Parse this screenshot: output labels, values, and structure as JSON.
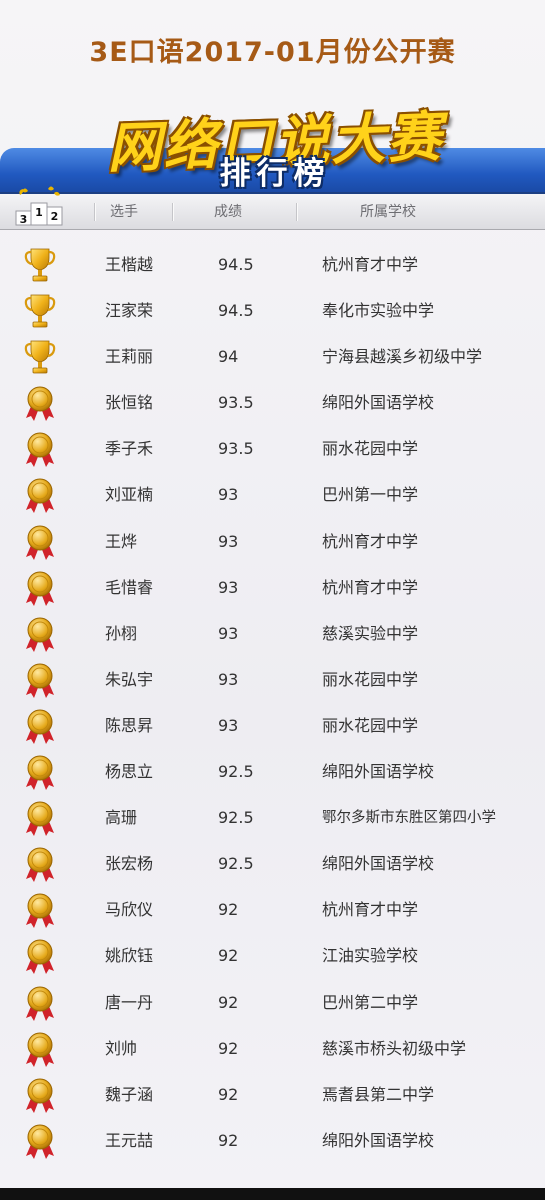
{
  "header": {
    "title": "3E口语2017-01月份公开赛",
    "banner_main": "网络口说大赛",
    "banner_sub": "排行榜"
  },
  "podium": {
    "left": "3",
    "center": "1",
    "right": "2"
  },
  "columns": {
    "player": "选手",
    "score": "成绩",
    "school": "所属学校"
  },
  "colors": {
    "accent": "#a65a16",
    "banner": "#2159c0",
    "gold": "#ffd21a"
  },
  "rows": [
    {
      "icon": "trophy-icon",
      "name": "王楷越",
      "score": "94.5",
      "school": "杭州育才中学"
    },
    {
      "icon": "trophy-icon",
      "name": "汪家荣",
      "score": "94.5",
      "school": "奉化市实验中学"
    },
    {
      "icon": "trophy-icon",
      "name": "王莉丽",
      "score": "94",
      "school": "宁海县越溪乡初级中学"
    },
    {
      "icon": "medal-icon",
      "name": "张恒铭",
      "score": "93.5",
      "school": "绵阳外国语学校"
    },
    {
      "icon": "medal-icon",
      "name": "季子禾",
      "score": "93.5",
      "school": "丽水花园中学"
    },
    {
      "icon": "medal-icon",
      "name": "刘亚楠",
      "score": "93",
      "school": "巴州第一中学"
    },
    {
      "icon": "medal-icon",
      "name": "王烨",
      "score": "93",
      "school": "杭州育才中学"
    },
    {
      "icon": "medal-icon",
      "name": "毛惜睿",
      "score": "93",
      "school": "杭州育才中学"
    },
    {
      "icon": "medal-icon",
      "name": "孙栩",
      "score": "93",
      "school": "慈溪实验中学"
    },
    {
      "icon": "medal-icon",
      "name": "朱弘宇",
      "score": "93",
      "school": "丽水花园中学"
    },
    {
      "icon": "medal-icon",
      "name": "陈思昇",
      "score": "93",
      "school": "丽水花园中学"
    },
    {
      "icon": "medal-icon",
      "name": "杨思立",
      "score": "92.5",
      "school": "绵阳外国语学校"
    },
    {
      "icon": "medal-icon",
      "name": "高珊",
      "score": "92.5",
      "school": "鄂尔多斯市东胜区第四小学"
    },
    {
      "icon": "medal-icon",
      "name": "张宏杨",
      "score": "92.5",
      "school": "绵阳外国语学校"
    },
    {
      "icon": "medal-icon",
      "name": "马欣仪",
      "score": "92",
      "school": "杭州育才中学"
    },
    {
      "icon": "medal-icon",
      "name": "姚欣钰",
      "score": "92",
      "school": "江油实验学校"
    },
    {
      "icon": "medal-icon",
      "name": "唐一丹",
      "score": "92",
      "school": "巴州第二中学"
    },
    {
      "icon": "medal-icon",
      "name": "刘帅",
      "score": "92",
      "school": "慈溪市桥头初级中学"
    },
    {
      "icon": "medal-icon",
      "name": "魏子涵",
      "score": "92",
      "school": "焉耆县第二中学"
    },
    {
      "icon": "medal-icon",
      "name": "王元喆",
      "score": "92",
      "school": "绵阳外国语学校"
    }
  ]
}
